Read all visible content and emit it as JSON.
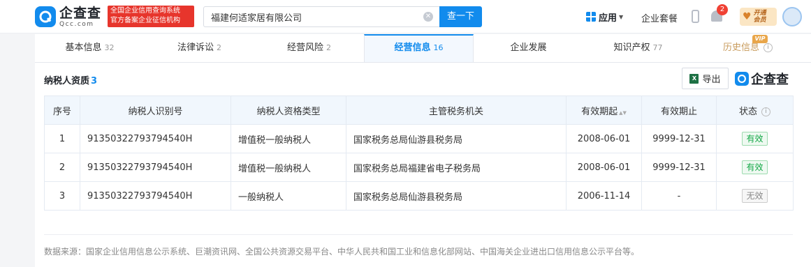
{
  "header": {
    "logo_cn": "企查查",
    "logo_en": "Qcc.com",
    "brand_line1": "全国企业信用查询系统",
    "brand_line2": "官方备案企业征信机构",
    "search_value": "福建何适家居有限公司",
    "search_button": "查一下",
    "app_menu": "应用",
    "package_link": "企业套餐",
    "notification_count": "2",
    "vip_line1": "开通",
    "vip_line2": "会员"
  },
  "tabs": [
    {
      "label": "基本信息",
      "count": "32"
    },
    {
      "label": "法律诉讼",
      "count": "2"
    },
    {
      "label": "经营风险",
      "count": "2"
    },
    {
      "label": "经营信息",
      "count": "16"
    },
    {
      "label": "企业发展",
      "count": ""
    },
    {
      "label": "知识产权",
      "count": "77"
    },
    {
      "label": "历史信息",
      "count": ""
    }
  ],
  "vip_corner": "VIP",
  "section": {
    "title": "纳税人资质",
    "count": "3",
    "export_label": "导出",
    "logo_text": "企查查"
  },
  "table": {
    "headers": [
      "序号",
      "纳税人识别号",
      "纳税人资格类型",
      "主管税务机关",
      "有效期起",
      "有效期止",
      "状态"
    ],
    "rows": [
      {
        "no": "1",
        "tax_id": "91350322793794540H",
        "type": "增值税一般纳税人",
        "authority": "国家税务总局仙游县税务局",
        "start": "2008-06-01",
        "end": "9999-12-31",
        "status": "有效"
      },
      {
        "no": "2",
        "tax_id": "91350322793794540H",
        "type": "增值税一般纳税人",
        "authority": "国家税务总局福建省电子税务局",
        "start": "2008-06-01",
        "end": "9999-12-31",
        "status": "有效"
      },
      {
        "no": "3",
        "tax_id": "91350322793794540H",
        "type": "一般纳税人",
        "authority": "国家税务总局仙游县税务局",
        "start": "2006-11-14",
        "end": "-",
        "status": "无效"
      }
    ]
  },
  "footer": {
    "source": "数据来源：国家企业信用信息公示系统、巨潮资讯网、全国公共资源交易平台、中华人民共和国工业和信息化部网站、中国海关企业进出口信用信息公示平台等。"
  },
  "colors": {
    "accent": "#128bed",
    "brand_red": "#e7352c",
    "valid_green": "#12a745"
  }
}
